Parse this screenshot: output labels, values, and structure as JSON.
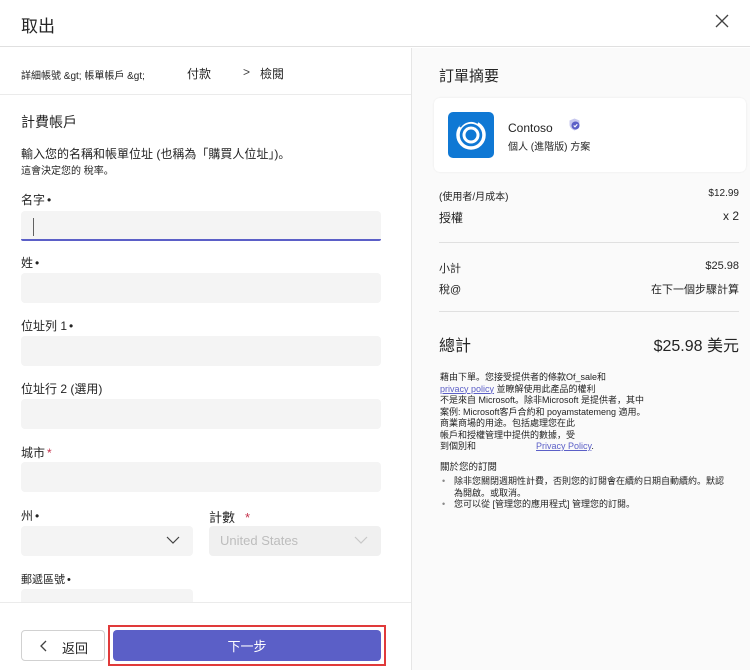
{
  "header": {
    "title": "取出",
    "close_icon": "close-icon"
  },
  "breadcrumb": {
    "step1": "詳細帳號 &gt; 帳單帳戶 &gt;",
    "step2": "付款",
    "separator": ">",
    "step3": "檢閱"
  },
  "form": {
    "section_title": "計費帳戶",
    "description": "輸入您的名稱和帳單位址 (也稱為「購買人位址」)。",
    "description_note": "這會決定您的 稅率。",
    "fields": {
      "first_name": {
        "label": "名字",
        "required_mark": "•",
        "value": ""
      },
      "last_name": {
        "label": "姓",
        "required_mark": "•",
        "value": ""
      },
      "address1": {
        "label": "位址列 1",
        "required_mark": "•",
        "value": ""
      },
      "address2": {
        "label": "位址行 2 (選用)",
        "value": ""
      },
      "city": {
        "label": "城市",
        "required_mark": "*",
        "value": ""
      },
      "state": {
        "label": "州",
        "required_mark": "•",
        "value": ""
      },
      "country": {
        "label": "計數",
        "required_mark": "*",
        "value": "United States"
      },
      "postal": {
        "label": "郵遞區號",
        "required_mark": "•",
        "value": ""
      }
    }
  },
  "footer": {
    "back_label": "返回",
    "next_label": "下一步"
  },
  "summary": {
    "title": "訂單摘要",
    "product": {
      "name": "Contoso",
      "plan": "個人 (進階版) 方案",
      "logo_icon": "contoso-logo-icon",
      "verified_icon": "verified-shield-icon"
    },
    "rows": {
      "cost_label": "(使用者/月成本)",
      "cost_value": "$12.99",
      "licenses_label": "授權",
      "licenses_value": "x 2",
      "subtotal_label": "小計",
      "subtotal_value": "$25.98",
      "tax_label": "稅@",
      "tax_value": "在下一個步驟計算",
      "total_label": "總計",
      "total_value": "$25.98 美元"
    },
    "legal": {
      "line1": "藉由下單。您接受提供者的條款Of_sale和",
      "privacy_link": "privacy policy",
      "line2": " 並瞭解使用此產品的權利",
      "line3": "不是來自 Microsoft。除非Microsoft 是提供者，其中",
      "line4": "案例: Microsoft客戶合約和 poyamstatemeng 適用。",
      "line5": "商業商場的用途。包括處理您在此",
      "line6": "帳戶和授權管理中提供的數據，受",
      "line7": "到個別和",
      "privacy_link2": "Privacy Policy",
      "line7_end": "."
    },
    "about": {
      "title": "關於您的訂閱",
      "bullets": [
        "除非您關閉週期性計費，否則您的訂閱會在續約日期自動續約。默認為開啟。或取消。",
        "您可以從 [管理您的應用程式] 管理您的訂閱。"
      ]
    }
  },
  "colors": {
    "accent": "#5b5fc7",
    "logo_bg": "#0f78d4",
    "required_red": "#c4314b",
    "highlight_border": "#e03a3a"
  }
}
